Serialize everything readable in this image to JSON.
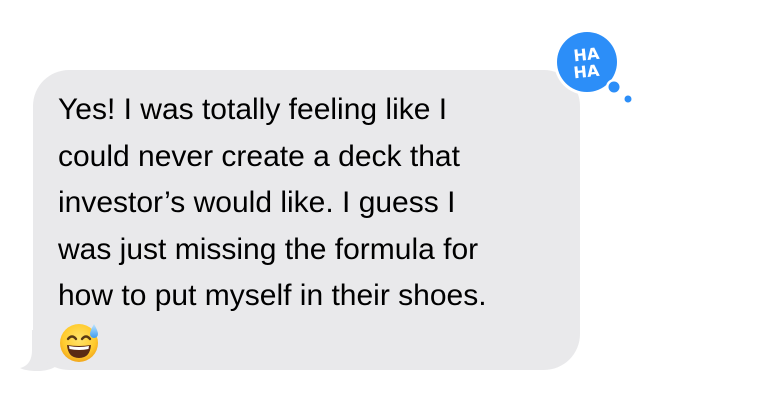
{
  "message": {
    "lines": [
      "Yes! I was totally feeling like I",
      "could never create a deck that",
      "investor’s would like. I guess I",
      "was just missing the formula for",
      "how to put myself in their shoes."
    ],
    "emoji_icon": "grinning-face-with-sweat-icon",
    "bubble_color": "#e9e9eb",
    "text_color": "#000000"
  },
  "tapback": {
    "line1": "HA",
    "line2": "HA",
    "icon": "haha-tapback-icon",
    "color": "#2c8ef8"
  }
}
